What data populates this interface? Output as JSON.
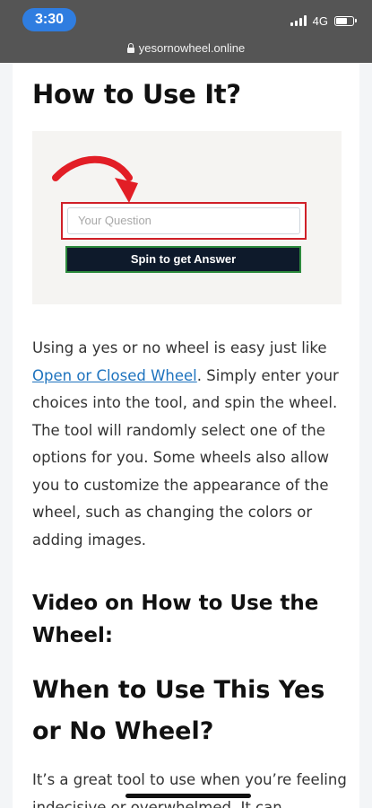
{
  "status_bar": {
    "time": "3:30",
    "network": "4G",
    "url": "yesornowheel.online"
  },
  "article": {
    "how_title": "How to Use It?",
    "demo": {
      "input_placeholder": "Your Question",
      "button_label": "Spin to get Answer"
    },
    "intro": {
      "before_link": "Using a yes or no wheel is easy just like ",
      "link_text": "Open or Closed Wheel",
      "after_link": ". Simply enter your choices into the tool, and spin the wheel. The tool will randomly select one of the options for you. Some wheels also allow you to customize the appearance of the wheel, such as changing the colors or adding images."
    },
    "video_title": "Video on How to Use the Wheel:",
    "when_title": "When to Use This Yes or No Wheel?",
    "last_para": "It’s a great tool to use when you’re feeling indecisive or overwhelmed. It can"
  },
  "colors": {
    "status_bar_bg": "#555555",
    "time_pill": "#2f7de0",
    "link": "#1e73be",
    "demo_border_red": "#d02028",
    "demo_button_bg": "#0e1a2b",
    "demo_button_border": "#2e8b3e"
  },
  "icons": [
    "lock-icon",
    "signal-icon",
    "battery-icon",
    "red-arrow-icon"
  ],
  "battery_level": 0.7
}
